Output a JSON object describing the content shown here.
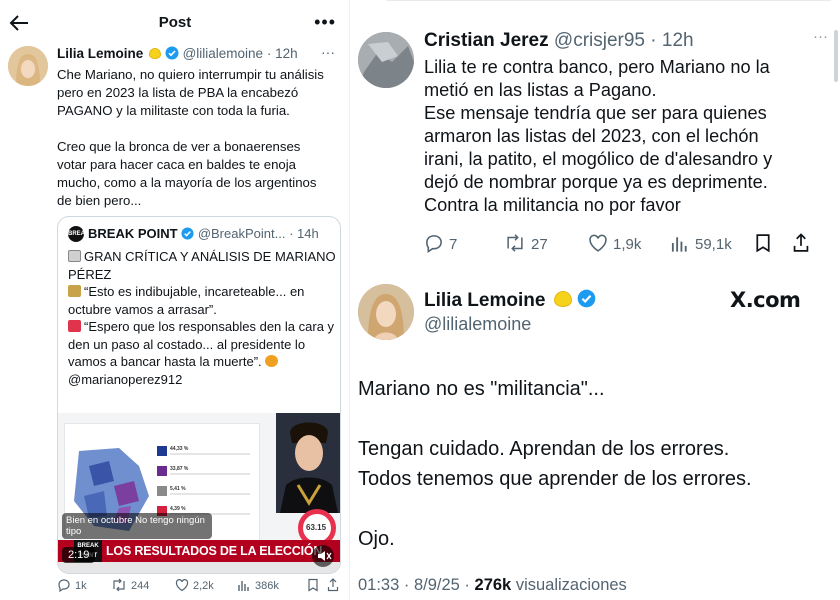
{
  "left_post": {
    "header": {
      "title": "Post"
    },
    "author": {
      "name": "Lilia Lemoine",
      "handle": "@lilialemoine",
      "time": "12h"
    },
    "text": "Che Mariano, no quiero interrumpir tu análisis\npero en 2023 la lista de PBA la encabezó\nPAGANO y la militaste con toda la furia.\n\nCreo que la bronca de ver a bonaerenses\nvotar para hacer caca en baldes te enoja\nmucho, como a la mayoría de los argentinos\nde bien pero...",
    "quote": {
      "name": "BREAK POINT",
      "handle": "@BreakPoint...",
      "time": "14h",
      "logo_text": "BREAK",
      "line1": "GRAN CRÍTICA Y ANÁLISIS DE MARIANO PÉREZ",
      "line2": "“Esto es indibujable, incareteable... en octubre vamos a arrasar”.",
      "line3": "“Espero que los responsables den la cara y den un paso al costado... al presidente lo vamos a bancar hasta la muerte”.",
      "mention": "@marianoperez912",
      "media": {
        "caption": "Bien en octubre No tengo ningún tipo",
        "banner": "LOS RESULTADOS DE LA ELECCIÓN",
        "banner_logo": "BREAK POINT",
        "duration": "2:19",
        "gauge": "63.15",
        "results": [
          {
            "pct": "44,33 %",
            "color": "#1f3a93"
          },
          {
            "pct": "33,87 %",
            "color": "#6a2c91"
          },
          {
            "pct": "5,41 %",
            "color": "#8a8a8a"
          },
          {
            "pct": "4,39 %",
            "color": "#d4213d"
          }
        ]
      }
    },
    "actions": {
      "replies": "1k",
      "reposts": "244",
      "likes": "2,2k",
      "views": "386k"
    }
  },
  "right_reply": {
    "author": {
      "name": "Cristian Jerez",
      "handle": "@crisjer95",
      "time": "12h"
    },
    "text": "Lilia te re contra banco, pero Mariano no la\nmetió en las listas a Pagano.\nEse mensaje tendría que ser para quienes\narmaron las listas del 2023, con el lechón\nirani, la patito, el mogólico de d'alesandro y\ndejó de nombrar porque ya es deprimente.\nContra la militancia no por favor",
    "actions": {
      "replies": "7",
      "reposts": "27",
      "likes": "1,9k",
      "views": "59,1k"
    }
  },
  "right_post": {
    "author": {
      "name": "Lilia Lemoine",
      "handle": "@lilialemoine"
    },
    "brand": "X.com",
    "text": "Mariano no es \"militancia\"...\n\nTengan cuidado. Aprendan de los errores.\nTodos tenemos que aprender de los errores.\n\nOjo.",
    "footer": {
      "time": "01:33 · 8/9/25 ·",
      "views": "276k",
      "views_label": "visualizaciones"
    }
  },
  "colors": {
    "verified": "#1d9bf0",
    "muted": "#536471",
    "banner": "#b3001e"
  },
  "icons": [
    "back-arrow-icon",
    "more-icon",
    "verified-icon",
    "lemon-icon",
    "reply-icon",
    "repost-icon",
    "like-icon",
    "views-icon",
    "bookmark-icon",
    "share-icon",
    "volume-icon"
  ]
}
